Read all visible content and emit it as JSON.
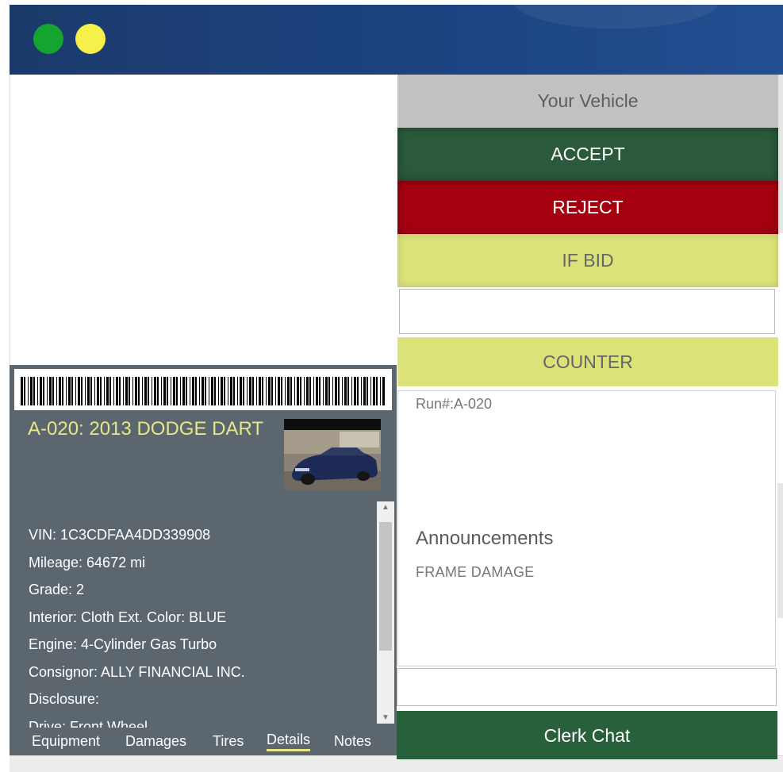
{
  "header": {
    "dots": [
      {
        "name": "green-status-dot",
        "color": "#13a52f"
      },
      {
        "name": "yellow-status-dot",
        "color": "#f6f04a"
      }
    ]
  },
  "vehicle": {
    "title": "A-020: 2013 DODGE DART",
    "details": [
      "VIN: 1C3CDFAA4DD339908",
      "Mileage: 64672 mi",
      "Grade: 2",
      "Interior: Cloth Ext. Color: BLUE",
      "Engine: 4-Cylinder Gas Turbo",
      "Consignor: ALLY FINANCIAL INC.",
      "Disclosure:",
      "Drive: Front Wheel"
    ]
  },
  "tabs": [
    {
      "label": "Equipment",
      "active": false
    },
    {
      "label": "Damages",
      "active": false
    },
    {
      "label": "Tires",
      "active": false
    },
    {
      "label": "Details",
      "active": true
    },
    {
      "label": "Notes",
      "active": false
    }
  ],
  "actions": {
    "your_vehicle": "Your Vehicle",
    "accept": "ACCEPT",
    "reject": "REJECT",
    "if_bid": "IF BID",
    "counter_value": "",
    "counter": "COUNTER"
  },
  "info": {
    "run_number": "Run#:A-020",
    "announcements_heading": "Announcements",
    "announcement": "FRAME DAMAGE"
  },
  "chat": {
    "input_value": "",
    "button": "Clerk Chat"
  },
  "colors": {
    "header": "#1d4583",
    "accept": "#2a5a3b",
    "reject": "#a50010",
    "if_bid": "#dbe27a",
    "panel": "#5c666e",
    "title": "#e7e78a",
    "chat": "#27603a"
  },
  "icons": {
    "barcode": "barcode-icon",
    "scroll_up": "scroll-up-icon",
    "scroll_down": "scroll-down-icon"
  }
}
